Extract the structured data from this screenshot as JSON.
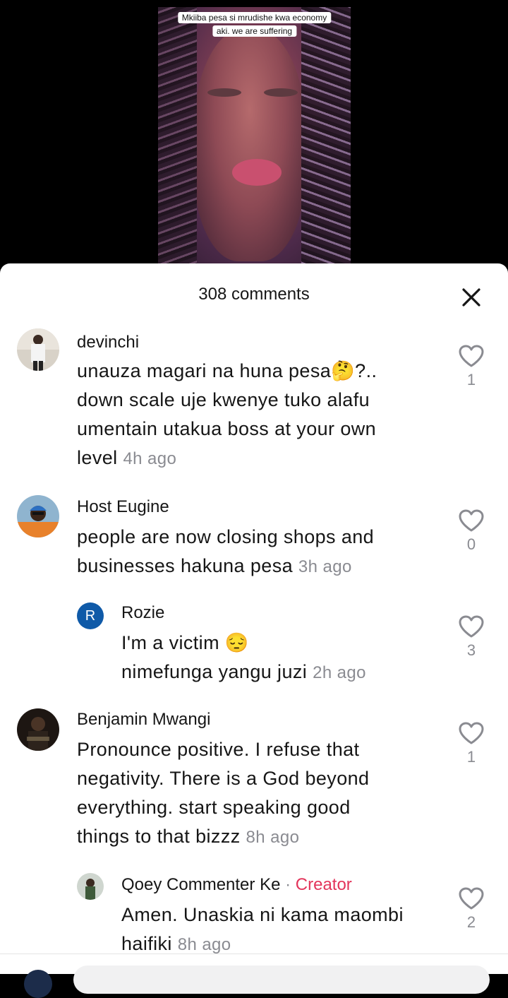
{
  "video": {
    "caption_line1": "Mkiiba pesa si mrudishe kwa economy",
    "caption_line2": "aki. we are suffering"
  },
  "comments_header": {
    "count_label": "308 comments",
    "close_icon": "close-icon"
  },
  "comments": [
    {
      "username": "devinchi",
      "text_line1": "unauza magari na huna pesa🤔?..",
      "text_line2": "down scale uje kwenye tuko alafu",
      "text_line3": "umentain utakua boss at your own",
      "text_line4": "level",
      "time": "4h ago",
      "likes": "1"
    },
    {
      "username": "Host Eugine",
      "text_line1": "people are now closing shops and",
      "text_line2": "businesses hakuna pesa",
      "time": "3h ago",
      "likes": "0"
    },
    {
      "username": "Rozie",
      "avatar_initial": "R",
      "text_line1": "I'm a victim 😔",
      "text_line2": "nimefunga yangu juzi",
      "time": "2h ago",
      "likes": "3"
    },
    {
      "username": "Benjamin Mwangi",
      "text_line1": "Pronounce positive. I refuse that",
      "text_line2": "negativity. There is a God beyond",
      "text_line3": "everything. start speaking good",
      "text_line4": "things to that bizzz",
      "time": "8h ago",
      "likes": "1"
    },
    {
      "username": "Qoey Commenter Ke",
      "separator": "·",
      "badge": "Creator",
      "text_line1": "Amen. Unaskia ni kama maombi",
      "text_line2": "haifiki",
      "time": "8h ago",
      "likes": "2"
    }
  ],
  "colors": {
    "creator_badge": "#e3355b",
    "muted_text": "#8a8b91",
    "rozie_avatar": "#0f5aa8"
  }
}
